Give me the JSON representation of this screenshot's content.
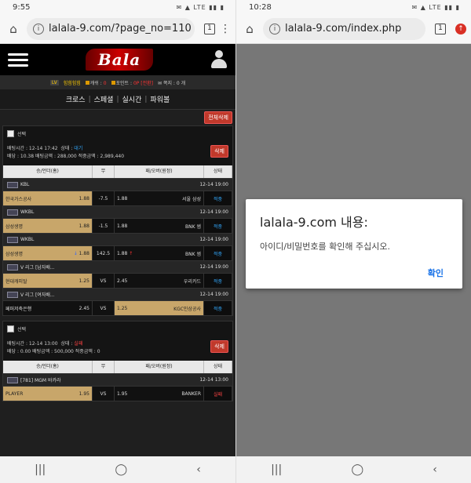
{
  "left": {
    "status": {
      "time": "9:55",
      "icons": "✉ ▲ LTE ▮▮ ▮"
    },
    "url": "lalala-9.com/?page_no=110",
    "tab_count": "1",
    "site": {
      "logo": "Bala",
      "infobar": {
        "level_tag": "LV",
        "nickname": "힘힘힘힘",
        "cash_label": "캐쉬 :",
        "cash_value": "0",
        "point_label": "포인트 :",
        "point_value": "0P",
        "convert_label": "[전환]",
        "memo_label": "쪽지 : 0 개"
      },
      "tabs": [
        "크로스",
        "스페셜",
        "실시간",
        "파워볼"
      ],
      "delete_all": "전체삭제",
      "cards": [
        {
          "select_label": "선택",
          "bet_time": "배팅시간 : 12-14 17:42",
          "state_label": "상태 :",
          "state_value": "대기",
          "state_color": "blue",
          "odds_line": "배당 : 10.38  배팅금액 : 288,000  적중금액 : 2,989,440",
          "delete_label": "삭제",
          "headers": [
            "승/언더(홈)",
            "무",
            "패/오버(원정)",
            "상태"
          ],
          "games": [
            {
              "league": "KBL",
              "date": "12-14 19:00",
              "home": "한국가스공사",
              "home_odds": "1.88",
              "mid": "-7.5",
              "away_odds": "1.88",
              "away": "서울 삼성",
              "status": "적중",
              "selected": "home",
              "home_arrow": "",
              "away_arrow": ""
            },
            {
              "league": "WKBL",
              "date": "12-14 19:00",
              "home": "삼성생명",
              "home_odds": "1.88",
              "mid": "-1.5",
              "away_odds": "1.88",
              "away": "BNK 썸",
              "status": "적중",
              "selected": "home",
              "home_arrow": "",
              "away_arrow": ""
            },
            {
              "league": "WKBL",
              "date": "12-14 19:00",
              "home": "삼성생명",
              "home_odds": "1.88",
              "mid": "142.5",
              "away_odds": "1.88",
              "away": "BNK 썸",
              "status": "적중",
              "selected": "home",
              "home_arrow": "↓",
              "away_arrow": "↑"
            },
            {
              "league": "V 리그 [남자배...",
              "date": "12-14 19:00",
              "home": "현대캐피탈",
              "home_odds": "1.25",
              "mid": "VS",
              "away_odds": "2.45",
              "away": "우리카드",
              "status": "적중",
              "selected": "home",
              "home_arrow": "",
              "away_arrow": ""
            },
            {
              "league": "V 리그 [여자배...",
              "date": "12-14 19:00",
              "home": "페퍼저축은행",
              "home_odds": "2.45",
              "mid": "VS",
              "away_odds": "1.25",
              "away": "KGC인삼공사",
              "status": "적중",
              "selected": "away",
              "home_arrow": "",
              "away_arrow": ""
            }
          ]
        },
        {
          "select_label": "선택",
          "bet_time": "배팅시간 : 12-14 13:00",
          "state_label": "상태 :",
          "state_value": "실패",
          "state_color": "red",
          "odds_line": "배당 : 0.00  배팅금액 : 500,000  적중금액 : 0",
          "delete_label": "삭제",
          "headers": [
            "승/언더(홈)",
            "무",
            "패/오버(원정)",
            "상태"
          ],
          "games": [
            {
              "league": "[781] MGM 바카라",
              "date": "12-14 13:00",
              "home": "PLAYER",
              "home_odds": "1.95",
              "mid": "VS",
              "away_odds": "1.95",
              "away": "BANKER",
              "status": "실패",
              "selected": "home",
              "home_arrow": "",
              "away_arrow": ""
            }
          ]
        }
      ]
    }
  },
  "right": {
    "status": {
      "time": "10:28",
      "icons": "✉ ▲ LTE ▮▮ ▮"
    },
    "url": "lalala-9.com/index.php",
    "tab_count": "1",
    "dialog": {
      "title": "lalala-9.com 내용:",
      "message": "아이디/비밀번호를 확인해 주십시오.",
      "ok": "확인"
    }
  },
  "nav": {
    "recents": "|||",
    "home": "◯",
    "back": "‹"
  }
}
